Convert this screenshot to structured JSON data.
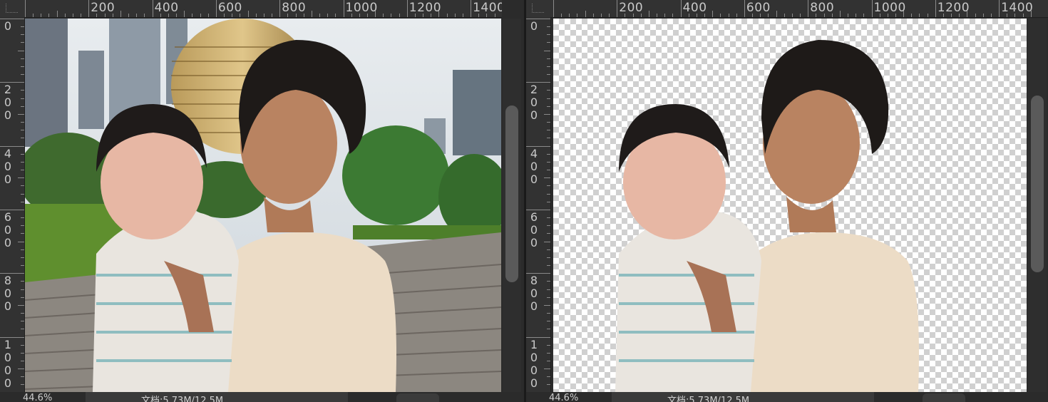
{
  "colors": {
    "background": "#2b2b2b",
    "ruler": "#323232",
    "ruler_text": "#c9c9c9",
    "checker_light": "#ffffff",
    "checker_dark": "#d0d0d0",
    "scroll_thumb": "#5a5a5a"
  },
  "left_panel": {
    "hruler_labels": [
      "200",
      "400",
      "600",
      "800",
      "1000",
      "1200",
      "1400"
    ],
    "vruler_labels": [
      [
        "0"
      ],
      [
        "2",
        "0",
        "0"
      ],
      [
        "4",
        "0",
        "0"
      ],
      [
        "6",
        "0",
        "0"
      ],
      [
        "8",
        "0",
        "0"
      ],
      [
        "1",
        "0",
        "0",
        "0"
      ]
    ],
    "status": {
      "zoom": "44.6%",
      "doc": "文档:5.73M/12.5M"
    },
    "image_alt": "original-photo"
  },
  "right_panel": {
    "hruler_labels": [
      "200",
      "400",
      "600",
      "800",
      "1000",
      "1200",
      "1400"
    ],
    "vruler_labels": [
      [
        "0"
      ],
      [
        "2",
        "0",
        "0"
      ],
      [
        "4",
        "0",
        "0"
      ],
      [
        "6",
        "0",
        "0"
      ],
      [
        "8",
        "0",
        "0"
      ],
      [
        "1",
        "0",
        "0",
        "0"
      ]
    ],
    "status": {
      "zoom": "44.6%",
      "doc": "文档:5.73M/12.5M"
    },
    "image_alt": "cutout-transparent"
  },
  "icons": {
    "ruler_origin": "ruler-origin-icon"
  }
}
